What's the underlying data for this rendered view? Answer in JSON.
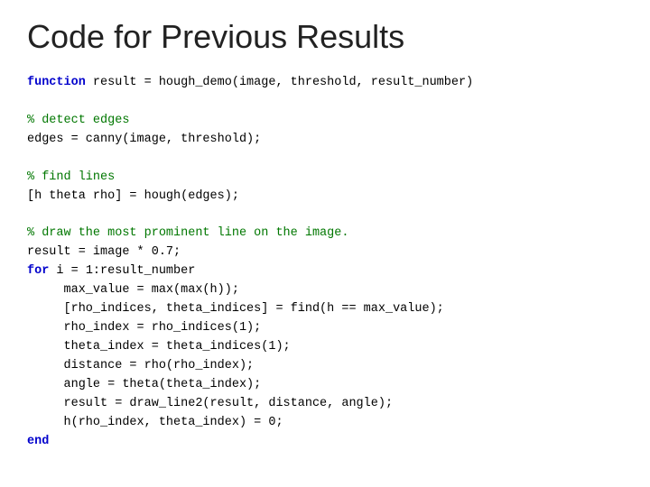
{
  "page": {
    "title": "Code for Previous Results"
  },
  "code": {
    "lines": [
      {
        "type": "function_line",
        "keyword": "function",
        "rest": " result = hough_demo(image, threshold, result_number)"
      },
      {
        "type": "blank"
      },
      {
        "type": "comment",
        "text": "% detect edges"
      },
      {
        "type": "normal",
        "text": "edges = canny(image, threshold);"
      },
      {
        "type": "blank"
      },
      {
        "type": "comment",
        "text": "% find lines"
      },
      {
        "type": "normal",
        "text": "[h theta rho] = hough(edges);"
      },
      {
        "type": "blank"
      },
      {
        "type": "comment",
        "text": "% draw the most prominent line on the image."
      },
      {
        "type": "normal",
        "text": "result = image * 0.7;"
      },
      {
        "type": "for_line",
        "keyword": "for",
        "rest": " i = 1:result_number"
      },
      {
        "type": "normal",
        "text": "     max_value = max(max(h));"
      },
      {
        "type": "normal",
        "text": "     [rho_indices, theta_indices] = find(h == max_value);"
      },
      {
        "type": "normal",
        "text": "     rho_index = rho_indices(1);"
      },
      {
        "type": "normal",
        "text": "     theta_index = theta_indices(1);"
      },
      {
        "type": "normal",
        "text": "     distance = rho(rho_index);"
      },
      {
        "type": "normal",
        "text": "     angle = theta(theta_index);"
      },
      {
        "type": "normal",
        "text": "     result = draw_line2(result, distance, angle);"
      },
      {
        "type": "normal",
        "text": "     h(rho_index, theta_index) = 0;"
      },
      {
        "type": "end_line",
        "keyword": "end"
      }
    ]
  }
}
